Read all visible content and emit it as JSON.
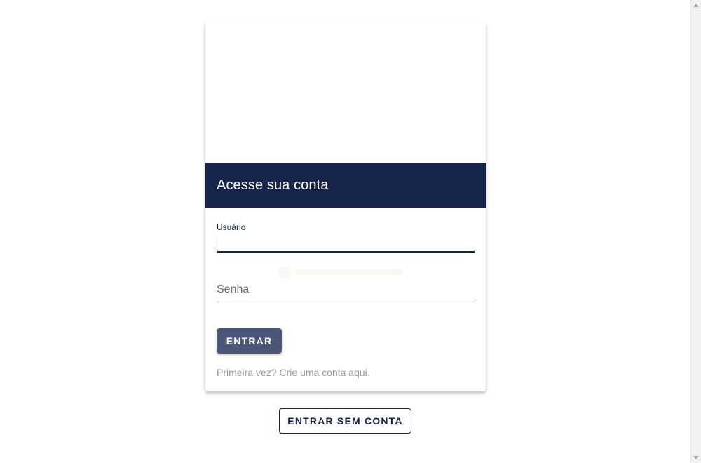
{
  "login_card": {
    "title": "Acesse sua conta",
    "username_field": {
      "label": "Usuário",
      "value": ""
    },
    "password_field": {
      "placeholder": "Senha",
      "value": ""
    },
    "submit_label": "ENTRAR",
    "signup_link": "Primeira vez? Crie uma conta aqui."
  },
  "guest_button_label": "ENTRAR SEM CONTA",
  "colors": {
    "primary": "#16234a",
    "button": "#4c5678",
    "muted_text": "#9a9a9a"
  }
}
